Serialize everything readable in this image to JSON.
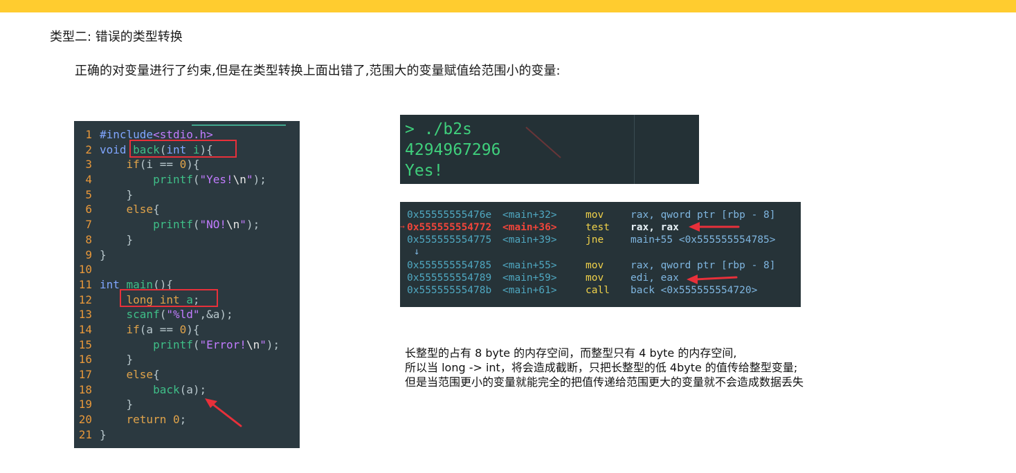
{
  "heading": "类型二: 错误的类型转换",
  "subheading": "正确的对变量进行了约束,但是在类型转换上面出错了,范围大的变量赋值给范围小的变量:",
  "code": [
    {
      "n": "1",
      "parts": [
        [
          "kw",
          "#include"
        ],
        [
          "str",
          "<stdio.h>"
        ]
      ]
    },
    {
      "n": "2",
      "parts": [
        [
          "kw",
          "void "
        ],
        [
          "fn",
          "back"
        ],
        [
          "plain",
          "("
        ],
        [
          "kw",
          "int "
        ],
        [
          "fn",
          "i"
        ],
        [
          "plain",
          "){"
        ]
      ]
    },
    {
      "n": "3",
      "parts": [
        [
          "plain",
          "    "
        ],
        [
          "kw2",
          "if"
        ],
        [
          "plain",
          "(i == "
        ],
        [
          "num",
          "0"
        ],
        [
          "plain",
          "){"
        ]
      ]
    },
    {
      "n": "4",
      "parts": [
        [
          "plain",
          "        "
        ],
        [
          "fn",
          "printf"
        ],
        [
          "plain",
          "("
        ],
        [
          "str",
          "\"Yes!"
        ],
        [
          "esc",
          "\\n"
        ],
        [
          "str",
          "\""
        ],
        [
          "plain",
          ");"
        ]
      ]
    },
    {
      "n": "5",
      "parts": [
        [
          "plain",
          "    }"
        ]
      ]
    },
    {
      "n": "6",
      "parts": [
        [
          "plain",
          "    "
        ],
        [
          "kw2",
          "else"
        ],
        [
          "plain",
          "{"
        ]
      ]
    },
    {
      "n": "7",
      "parts": [
        [
          "plain",
          "        "
        ],
        [
          "fn",
          "printf"
        ],
        [
          "plain",
          "("
        ],
        [
          "str",
          "\"NO!"
        ],
        [
          "esc",
          "\\n"
        ],
        [
          "str",
          "\""
        ],
        [
          "plain",
          ");"
        ]
      ]
    },
    {
      "n": "8",
      "parts": [
        [
          "plain",
          "    }"
        ]
      ]
    },
    {
      "n": "9",
      "parts": [
        [
          "plain",
          "}"
        ]
      ]
    },
    {
      "n": "10",
      "parts": [
        [
          "plain",
          ""
        ]
      ]
    },
    {
      "n": "11",
      "parts": [
        [
          "kw",
          "int "
        ],
        [
          "fn",
          "main"
        ],
        [
          "plain",
          "(){"
        ]
      ]
    },
    {
      "n": "12",
      "parts": [
        [
          "plain",
          "    "
        ],
        [
          "kw2",
          "long int "
        ],
        [
          "fn",
          "a"
        ],
        [
          "plain",
          ";"
        ]
      ]
    },
    {
      "n": "13",
      "parts": [
        [
          "plain",
          "    "
        ],
        [
          "fn",
          "scanf"
        ],
        [
          "plain",
          "("
        ],
        [
          "str",
          "\"%ld\""
        ],
        [
          "plain",
          ",&a);"
        ]
      ]
    },
    {
      "n": "14",
      "parts": [
        [
          "plain",
          "    "
        ],
        [
          "kw2",
          "if"
        ],
        [
          "plain",
          "(a == "
        ],
        [
          "num",
          "0"
        ],
        [
          "plain",
          "){"
        ]
      ]
    },
    {
      "n": "15",
      "parts": [
        [
          "plain",
          "        "
        ],
        [
          "fn",
          "printf"
        ],
        [
          "plain",
          "("
        ],
        [
          "str",
          "\"Error!"
        ],
        [
          "esc",
          "\\n"
        ],
        [
          "str",
          "\""
        ],
        [
          "plain",
          ");"
        ]
      ]
    },
    {
      "n": "16",
      "parts": [
        [
          "plain",
          "    }"
        ]
      ]
    },
    {
      "n": "17",
      "parts": [
        [
          "plain",
          "    "
        ],
        [
          "kw2",
          "else"
        ],
        [
          "plain",
          "{"
        ]
      ]
    },
    {
      "n": "18",
      "parts": [
        [
          "plain",
          "        "
        ],
        [
          "fn",
          "back"
        ],
        [
          "plain",
          "(a);"
        ]
      ]
    },
    {
      "n": "19",
      "parts": [
        [
          "plain",
          "    }"
        ]
      ]
    },
    {
      "n": "20",
      "parts": [
        [
          "plain",
          "    "
        ],
        [
          "kw2",
          "return "
        ],
        [
          "num",
          "0"
        ],
        [
          "plain",
          ";"
        ]
      ]
    },
    {
      "n": "21",
      "parts": [
        [
          "plain",
          "}"
        ]
      ]
    }
  ],
  "terminal": {
    "lines": [
      "> ./b2s",
      "4294967296",
      "Yes!"
    ]
  },
  "disasm": {
    "rows": [
      {
        "addr": "0x55555555476e",
        "sym": "<main+32>",
        "op": "mov",
        "args": "rax, qword ptr [rbp - 8]",
        "current": false
      },
      {
        "addr": "0x555555554772",
        "sym": "<main+36>",
        "op": "test",
        "args": "rax, rax",
        "current": true
      },
      {
        "addr": "0x555555554775",
        "sym": "<main+39>",
        "op": "jne",
        "args": "main+55 <0x555555554785>",
        "current": false
      },
      {
        "addr": "0x555555554785",
        "sym": "<main+55>",
        "op": "mov",
        "args": "rax, qword ptr [rbp - 8]",
        "current": false
      },
      {
        "addr": "0x555555554789",
        "sym": "<main+59>",
        "op": "mov",
        "args": "edi, eax",
        "current": false
      },
      {
        "addr": "0x55555555478b",
        "sym": "<main+61>",
        "op": "call",
        "args": "back <0x555555554720>",
        "current": false
      }
    ],
    "jump_glyph": "↓"
  },
  "explanation": [
    "长整型的占有 8 byte 的内存空间，而整型只有 4 byte 的内存空间,",
    "所以当 long -> int，将会造成截断，只把长整型的低 4byte 的值传给整型变量;",
    "但是当范围更小的变量就能完全的把值传递给范围更大的变量就不会造成数据丢失"
  ],
  "colors": {
    "accent_bar": "#ffcc2f",
    "highlight": "#e8303a"
  }
}
